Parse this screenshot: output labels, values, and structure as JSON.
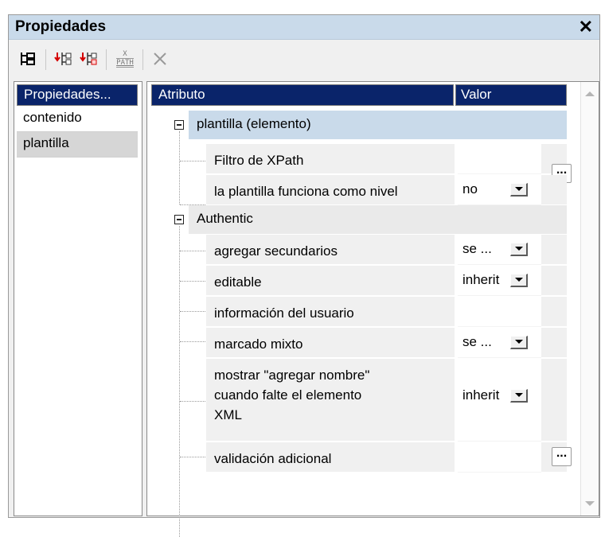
{
  "window": {
    "title": "Propiedades",
    "close_glyph": "✕"
  },
  "toolbar": {
    "xpath_top": "X",
    "xpath_bottom": "PATH",
    "icons": [
      "tree-layout-icon",
      "insert-child-icon",
      "insert-sibling-icon",
      "xpath-icon",
      "delete-icon"
    ]
  },
  "left": {
    "header": "Propiedades...",
    "items": [
      "contenido",
      "plantilla"
    ],
    "selected": "plantilla"
  },
  "grid": {
    "col_attr": "Atributo",
    "col_value": "Valor",
    "groups": [
      {
        "label": "plantilla (elemento)",
        "selected": true,
        "rows": [
          {
            "label": "Filtro de XPath",
            "value": "",
            "control": "ellipsis"
          },
          {
            "label": "la plantilla funciona como nivel",
            "value": "no",
            "control": "dropdown"
          }
        ]
      },
      {
        "label": "Authentic",
        "selected": false,
        "rows": [
          {
            "label": "agregar secundarios",
            "value": "se ...",
            "control": "dropdown"
          },
          {
            "label": "editable",
            "value": "inherit",
            "control": "dropdown"
          },
          {
            "label": "información del usuario",
            "value": "",
            "control": "none"
          },
          {
            "label": "marcado mixto",
            "value": "se ...",
            "control": "dropdown"
          },
          {
            "label": "mostrar \"agregar nombre\"\ncuando falte el elemento\nXML",
            "value": "inherit",
            "control": "dropdown"
          },
          {
            "label": "validación adicional",
            "value": "",
            "control": "ellipsis"
          }
        ]
      }
    ],
    "ellipsis_label": "..."
  },
  "colors": {
    "header_bg": "#0a246a",
    "title_bg": "#c9daea",
    "selected_row": "#c9daea"
  }
}
